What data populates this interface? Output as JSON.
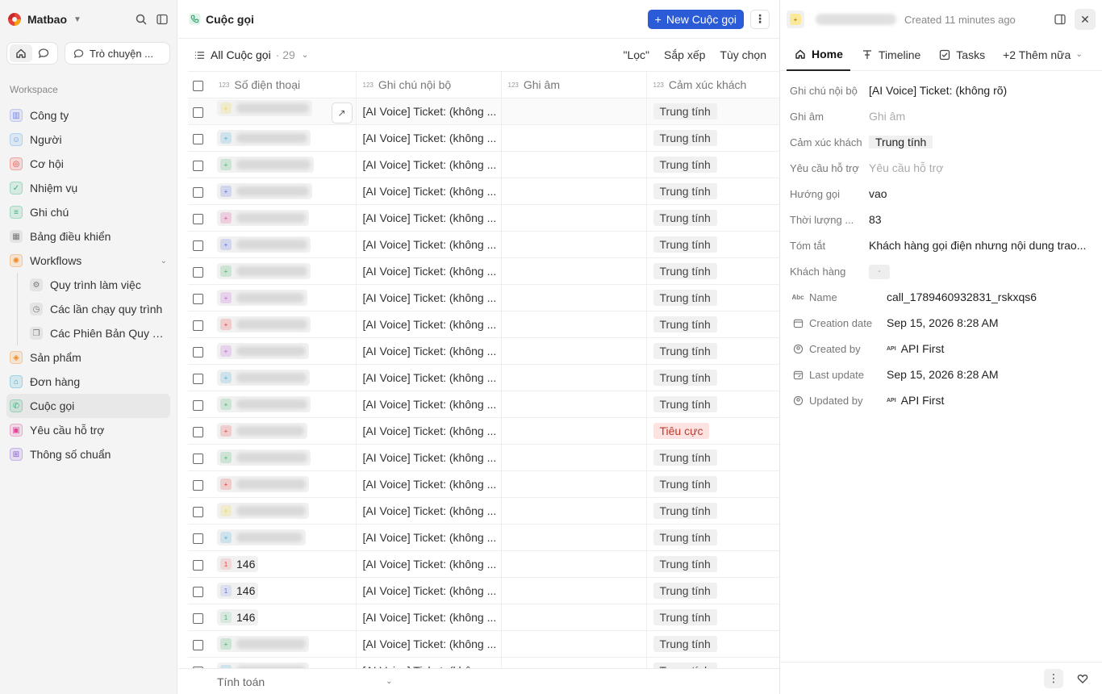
{
  "sidebar": {
    "workspace_name": "Matbao",
    "chat_label": "Trò chuyện ...",
    "section_label": "Workspace",
    "items": [
      {
        "label": "Công ty",
        "icon": "building-icon",
        "color": "#7b8be8"
      },
      {
        "label": "Người",
        "icon": "person-icon",
        "color": "#5aa0e8"
      },
      {
        "label": "Cơ hội",
        "icon": "target-icon",
        "color": "#e8413a"
      },
      {
        "label": "Nhiệm vụ",
        "icon": "checkbox-icon",
        "color": "#34b27b"
      },
      {
        "label": "Ghi chú",
        "icon": "note-icon",
        "color": "#34b27b"
      },
      {
        "label": "Bảng điều khiển",
        "icon": "dashboard-icon",
        "color": "#777777"
      },
      {
        "label": "Workflows",
        "icon": "workflow-icon",
        "color": "#f08a24"
      },
      {
        "label": "Quy trình làm việc",
        "icon": "settings-icon",
        "color": "#777777"
      },
      {
        "label": "Các lần chạy quy trình",
        "icon": "history-icon",
        "color": "#777777"
      },
      {
        "label": "Các Phiên Bản Quy Tr...",
        "icon": "versions-icon",
        "color": "#777777"
      },
      {
        "label": "Sản phẩm",
        "icon": "box-icon",
        "color": "#f08a24"
      },
      {
        "label": "Đơn hàng",
        "icon": "cart-icon",
        "color": "#2ba5c9"
      },
      {
        "label": "Cuộc gọi",
        "icon": "phone-icon",
        "color": "#34b27b"
      },
      {
        "label": "Yêu cầu hỗ trợ",
        "icon": "ticket-icon",
        "color": "#e0489a"
      },
      {
        "label": "Thông số chuẩn",
        "icon": "ruler-icon",
        "color": "#8a5cd6"
      }
    ]
  },
  "main": {
    "title": "Cuộc gọi",
    "new_button": "New Cuộc gọi",
    "view_name": "All Cuộc gọi",
    "view_count": "· 29",
    "actions": {
      "filter": "\"Lọc\"",
      "sort": "Sắp xếp",
      "options": "Tùy chọn"
    },
    "columns": [
      "Số điện thoại",
      "Ghi chú nội bộ",
      "Ghi âm",
      "Cảm xúc khách"
    ],
    "footer_label": "Tính toán",
    "rows": [
      {
        "dot": "#f2d53c",
        "phone": "",
        "note": "[AI Voice] Ticket: (không ...",
        "sentiment": "Trung tính",
        "neg": false
      },
      {
        "dot": "#45a8d6",
        "phone": "",
        "note": "[AI Voice] Ticket: (không ...",
        "sentiment": "Trung tính",
        "neg": false
      },
      {
        "dot": "#3fb56b",
        "phone": "",
        "note": "[AI Voice] Ticket: (không ...",
        "sentiment": "Trung tính",
        "neg": false
      },
      {
        "dot": "#5b6fe0",
        "phone": "",
        "note": "[AI Voice] Ticket: (không ...",
        "sentiment": "Trung tính",
        "neg": false
      },
      {
        "dot": "#e0489a",
        "phone": "",
        "note": "[AI Voice] Ticket: (không ...",
        "sentiment": "Trung tính",
        "neg": false
      },
      {
        "dot": "#5b6fe0",
        "phone": "",
        "note": "[AI Voice] Ticket: (không ...",
        "sentiment": "Trung tính",
        "neg": false
      },
      {
        "dot": "#3fb56b",
        "phone": "",
        "note": "[AI Voice] Ticket: (không ...",
        "sentiment": "Trung tính",
        "neg": false
      },
      {
        "dot": "#c45ad6",
        "phone": "",
        "note": "[AI Voice] Ticket: (không ...",
        "sentiment": "Trung tính",
        "neg": false
      },
      {
        "dot": "#e8413a",
        "phone": "",
        "note": "[AI Voice] Ticket: (không ...",
        "sentiment": "Trung tính",
        "neg": false
      },
      {
        "dot": "#c45ad6",
        "phone": "",
        "note": "[AI Voice] Ticket: (không ...",
        "sentiment": "Trung tính",
        "neg": false
      },
      {
        "dot": "#45a8d6",
        "phone": "",
        "note": "[AI Voice] Ticket: (không ...",
        "sentiment": "Trung tính",
        "neg": false
      },
      {
        "dot": "#3fb56b",
        "phone": "",
        "note": "[AI Voice] Ticket: (không ...",
        "sentiment": "Trung tính",
        "neg": false
      },
      {
        "dot": "#e8413a",
        "phone": "",
        "note": "[AI Voice] Ticket: (không ...",
        "sentiment": "Tiêu cực",
        "neg": true
      },
      {
        "dot": "#3fb56b",
        "phone": "",
        "note": "[AI Voice] Ticket: (không ...",
        "sentiment": "Trung tính",
        "neg": false
      },
      {
        "dot": "#e8413a",
        "phone": "",
        "note": "[AI Voice] Ticket: (không ...",
        "sentiment": "Trung tính",
        "neg": false
      },
      {
        "dot": "#f2d53c",
        "phone": "",
        "note": "[AI Voice] Ticket: (không ...",
        "sentiment": "Trung tính",
        "neg": false
      },
      {
        "dot": "#45a8d6",
        "phone": "",
        "note": "[AI Voice] Ticket: (không ...",
        "sentiment": "Trung tính",
        "neg": false
      },
      {
        "dot": "#e8413a",
        "dot_label": "1",
        "phone": "146",
        "note": "[AI Voice] Ticket: (không ...",
        "sentiment": "Trung tính",
        "neg": false
      },
      {
        "dot": "#5b6fe0",
        "dot_label": "1",
        "phone": "146",
        "note": "[AI Voice] Ticket: (không ...",
        "sentiment": "Trung tính",
        "neg": false
      },
      {
        "dot": "#3fb56b",
        "dot_label": "1",
        "phone": "146",
        "note": "[AI Voice] Ticket: (không ...",
        "sentiment": "Trung tính",
        "neg": false
      },
      {
        "dot": "#3fb56b",
        "phone": "",
        "note": "[AI Voice] Ticket: (không ...",
        "sentiment": "Trung tính",
        "neg": false
      },
      {
        "dot": "#45a8d6",
        "phone": "",
        "note": "[AI Voice] Ticket: (không ...",
        "sentiment": "Trung tính",
        "neg": false
      }
    ]
  },
  "panel": {
    "created": "Created 11 minutes ago",
    "tabs": {
      "home": "Home",
      "timeline": "Timeline",
      "tasks": "Tasks",
      "more": "+2 Thêm nữa"
    },
    "fields": [
      {
        "label": "Ghi chú nội bộ",
        "value": "[AI Voice] Ticket: (không rõ)",
        "type": "text"
      },
      {
        "label": "Ghi âm",
        "value": "Ghi âm",
        "type": "placeholder"
      },
      {
        "label": "Cảm xúc khách",
        "value": "Trung tính",
        "type": "badge"
      },
      {
        "label": "Yêu cầu hỗ trợ",
        "value": "Yêu cầu hỗ trợ",
        "type": "placeholder"
      },
      {
        "label": "Hướng gọi",
        "value": "vao",
        "type": "text"
      },
      {
        "label": "Thời lượng ...",
        "value": "83",
        "type": "text"
      },
      {
        "label": "Tóm tắt",
        "value": "Khách hàng gọi điện nhưng nội dung trao...",
        "type": "text"
      },
      {
        "label": "Khách hàng",
        "value": "-",
        "type": "empty"
      }
    ],
    "meta": [
      {
        "label": "Name",
        "icon": "abc-icon",
        "value": "call_1789460932831_rskxqs6"
      },
      {
        "label": "Creation date",
        "icon": "calendar-icon",
        "value": "Sep 15, 2026 8:28 AM"
      },
      {
        "label": "Created by",
        "icon": "user-circle-icon",
        "value": "API First",
        "api": true
      },
      {
        "label": "Last update",
        "icon": "calendar-edit-icon",
        "value": "Sep 15, 2026 8:28 AM"
      },
      {
        "label": "Updated by",
        "icon": "user-circle-icon",
        "value": "API First",
        "api": true
      }
    ],
    "api_tag": "API"
  }
}
